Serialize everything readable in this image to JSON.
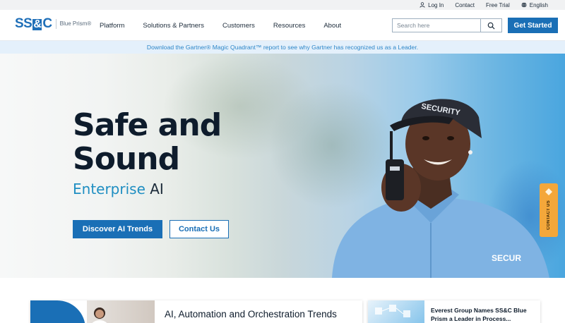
{
  "utility_bar": {
    "login": "Log In",
    "contact": "Contact",
    "free_trial": "Free Trial",
    "language": "English"
  },
  "header": {
    "logo_mark_left": "SS",
    "logo_mark_amp": "&",
    "logo_mark_right": "C",
    "logo_sub": "Blue Prism®",
    "nav": [
      "Platform",
      "Solutions & Partners",
      "Customers",
      "Resources",
      "About"
    ],
    "search_placeholder": "Search here",
    "cta": "Get Started"
  },
  "announcement": "Download the Gartner® Magic Quadrant™ report to see why Gartner has recognized us as a Leader.",
  "hero": {
    "title_line1": "Safe and",
    "title_line2": "Sound",
    "subtitle_accent": "Enterprise",
    "subtitle_rest": " AI",
    "primary_button": "Discover AI Trends",
    "secondary_button": "Contact Us",
    "cap_text": "SECURITY",
    "shirt_text": "SECUR"
  },
  "side_tab": {
    "label": "CONTACT US"
  },
  "cards": {
    "left_title": "AI, Automation and Orchestration Trends",
    "right_title_line1": "Everest Group Names SS&C Blue",
    "right_title_line2": "Prism a Leader in Process..."
  },
  "colors": {
    "brand_blue": "#1a6fb6",
    "accent_teal": "#1f8ec2",
    "side_tab": "#f4a73a",
    "announce_bg": "#e4f0fb"
  }
}
